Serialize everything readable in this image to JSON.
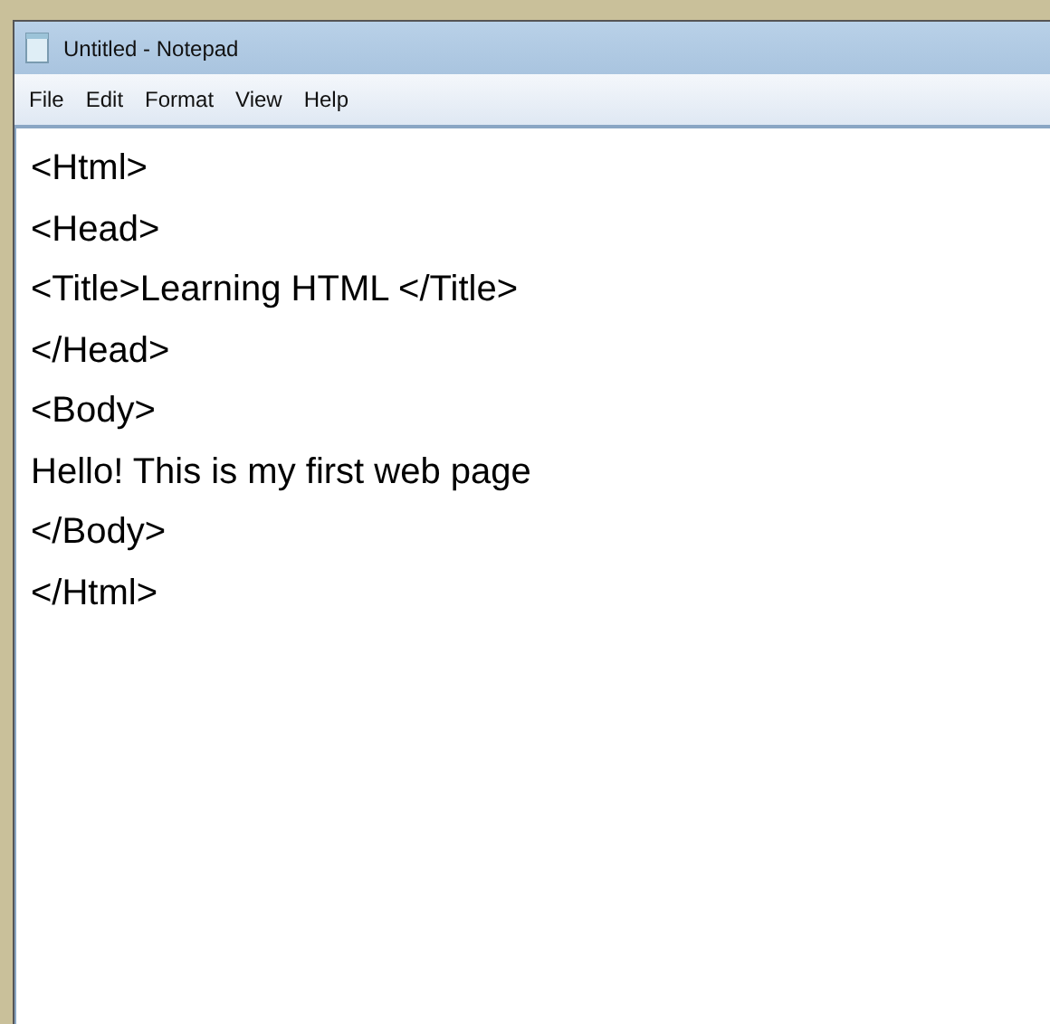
{
  "window": {
    "title": "Untitled - Notepad"
  },
  "menu": [
    "File",
    "Edit",
    "Format",
    "View",
    "Help"
  ],
  "editor": {
    "lines": [
      "<Html>",
      "<Head>",
      "<Title>Learning HTML </Title>",
      "</Head>",
      "<Body>",
      "Hello! This is my first web page",
      "</Body>",
      "</Html>"
    ]
  }
}
